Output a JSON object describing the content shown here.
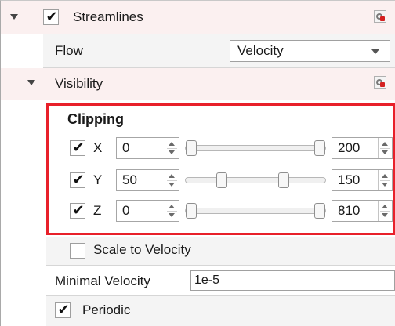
{
  "streamlines": {
    "title": "Streamlines",
    "enabled": true
  },
  "flow": {
    "label": "Flow",
    "value": "Velocity"
  },
  "visibility": {
    "label": "Visibility"
  },
  "clipping": {
    "title": "Clipping",
    "axes": [
      {
        "axis": "X",
        "checked": true,
        "min": "0",
        "max": "200",
        "low_fraction": 0.0,
        "high_fraction": 1.0
      },
      {
        "axis": "Y",
        "checked": true,
        "min": "50",
        "max": "150",
        "low_fraction": 0.35,
        "high_fraction": 0.75
      },
      {
        "axis": "Z",
        "checked": true,
        "min": "0",
        "max": "810",
        "low_fraction": 0.0,
        "high_fraction": 1.0
      }
    ]
  },
  "scale_to_velocity": {
    "label": "Scale to Velocity",
    "checked": false
  },
  "minimal_velocity": {
    "label": "Minimal Velocity",
    "value": "1e-5"
  },
  "periodic": {
    "label": "Periodic",
    "checked": true
  },
  "icons": {
    "check": "✔",
    "section_toggle": "triangle-down",
    "settings": "gear-badge"
  },
  "colors": {
    "highlight_border": "#e8202a",
    "section_bg": "#fbf0f0"
  }
}
